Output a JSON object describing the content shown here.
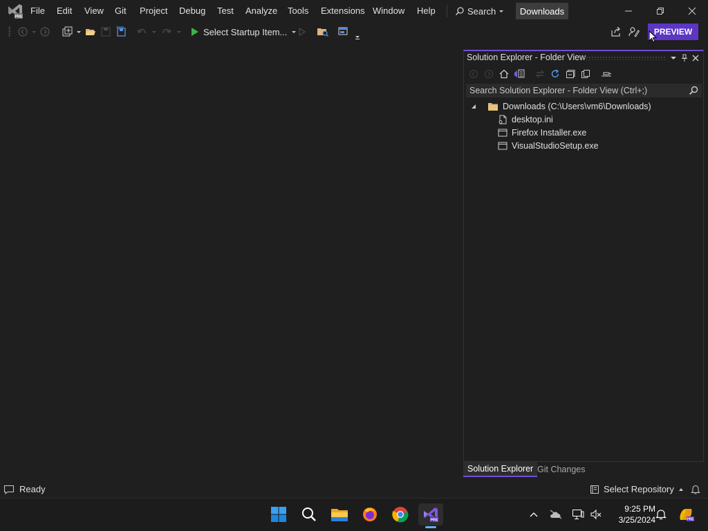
{
  "titlebar": {
    "menu": [
      "File",
      "Edit",
      "View",
      "Git",
      "Project",
      "Debug",
      "Test",
      "Analyze",
      "Tools",
      "Extensions",
      "Window",
      "Help"
    ],
    "search_label": "Search",
    "title_badge": "Downloads"
  },
  "toolbar": {
    "startup_label": "Select Startup Item...",
    "preview_label": "PREVIEW"
  },
  "solution_explorer": {
    "title": "Solution Explorer - Folder View",
    "search_placeholder": "Search Solution Explorer - Folder View (Ctrl+;)",
    "root": "Downloads (C:\\Users\\vm6\\Downloads)",
    "files": [
      "desktop.ini",
      "Firefox Installer.exe",
      "VisualStudioSetup.exe"
    ],
    "tabs": [
      "Solution Explorer",
      "Git Changes"
    ]
  },
  "statusbar": {
    "status": "Ready",
    "repository": "Select Repository"
  },
  "taskbar": {
    "time": "9:25 PM",
    "date": "3/25/2024"
  },
  "colors": {
    "accent": "#5b37c4",
    "background": "#1f1f1f",
    "taskbar": "#1c1c1c"
  }
}
